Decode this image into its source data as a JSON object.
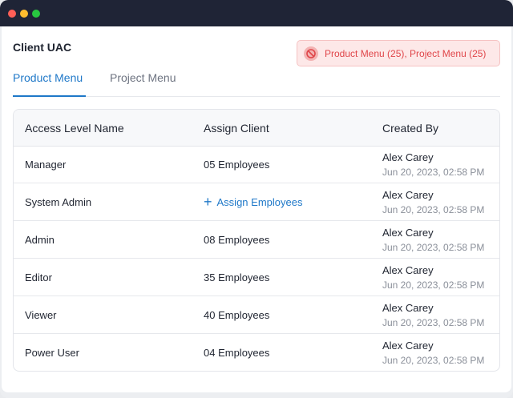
{
  "window": {
    "traffic_lights": [
      "close",
      "minimize",
      "maximize"
    ]
  },
  "page": {
    "title": "Client UAC"
  },
  "badge": {
    "text": "Product Menu (25), Project Menu (25)",
    "icon": "no-access-icon",
    "color": "#e0464a"
  },
  "tabs": [
    {
      "label": "Product Menu",
      "active": true
    },
    {
      "label": "Project Menu",
      "active": false
    }
  ],
  "table": {
    "headers": [
      "Access Level Name",
      "Assign Client",
      "Created By"
    ],
    "rows": [
      {
        "name": "Manager",
        "assign": "05 Employees",
        "assign_is_action": false,
        "created_by": "Alex Carey",
        "created_at": "Jun 20, 2023, 02:58 PM"
      },
      {
        "name": "System Admin",
        "assign": "Assign Employees",
        "assign_is_action": true,
        "created_by": "Alex Carey",
        "created_at": "Jun 20, 2023, 02:58 PM"
      },
      {
        "name": "Admin",
        "assign": "08 Employees",
        "assign_is_action": false,
        "created_by": "Alex Carey",
        "created_at": "Jun 20, 2023, 02:58 PM"
      },
      {
        "name": "Editor",
        "assign": "35 Employees",
        "assign_is_action": false,
        "created_by": "Alex Carey",
        "created_at": "Jun 20, 2023, 02:58 PM"
      },
      {
        "name": "Viewer",
        "assign": "40 Employees",
        "assign_is_action": false,
        "created_by": "Alex Carey",
        "created_at": "Jun 20, 2023, 02:58 PM"
      },
      {
        "name": "Power User",
        "assign": "04 Employees",
        "assign_is_action": false,
        "created_by": "Alex Carey",
        "created_at": "Jun 20, 2023, 02:58 PM"
      }
    ]
  },
  "colors": {
    "accent": "#1f78c8",
    "danger": "#e0464a",
    "titlebar": "#1f2436"
  }
}
